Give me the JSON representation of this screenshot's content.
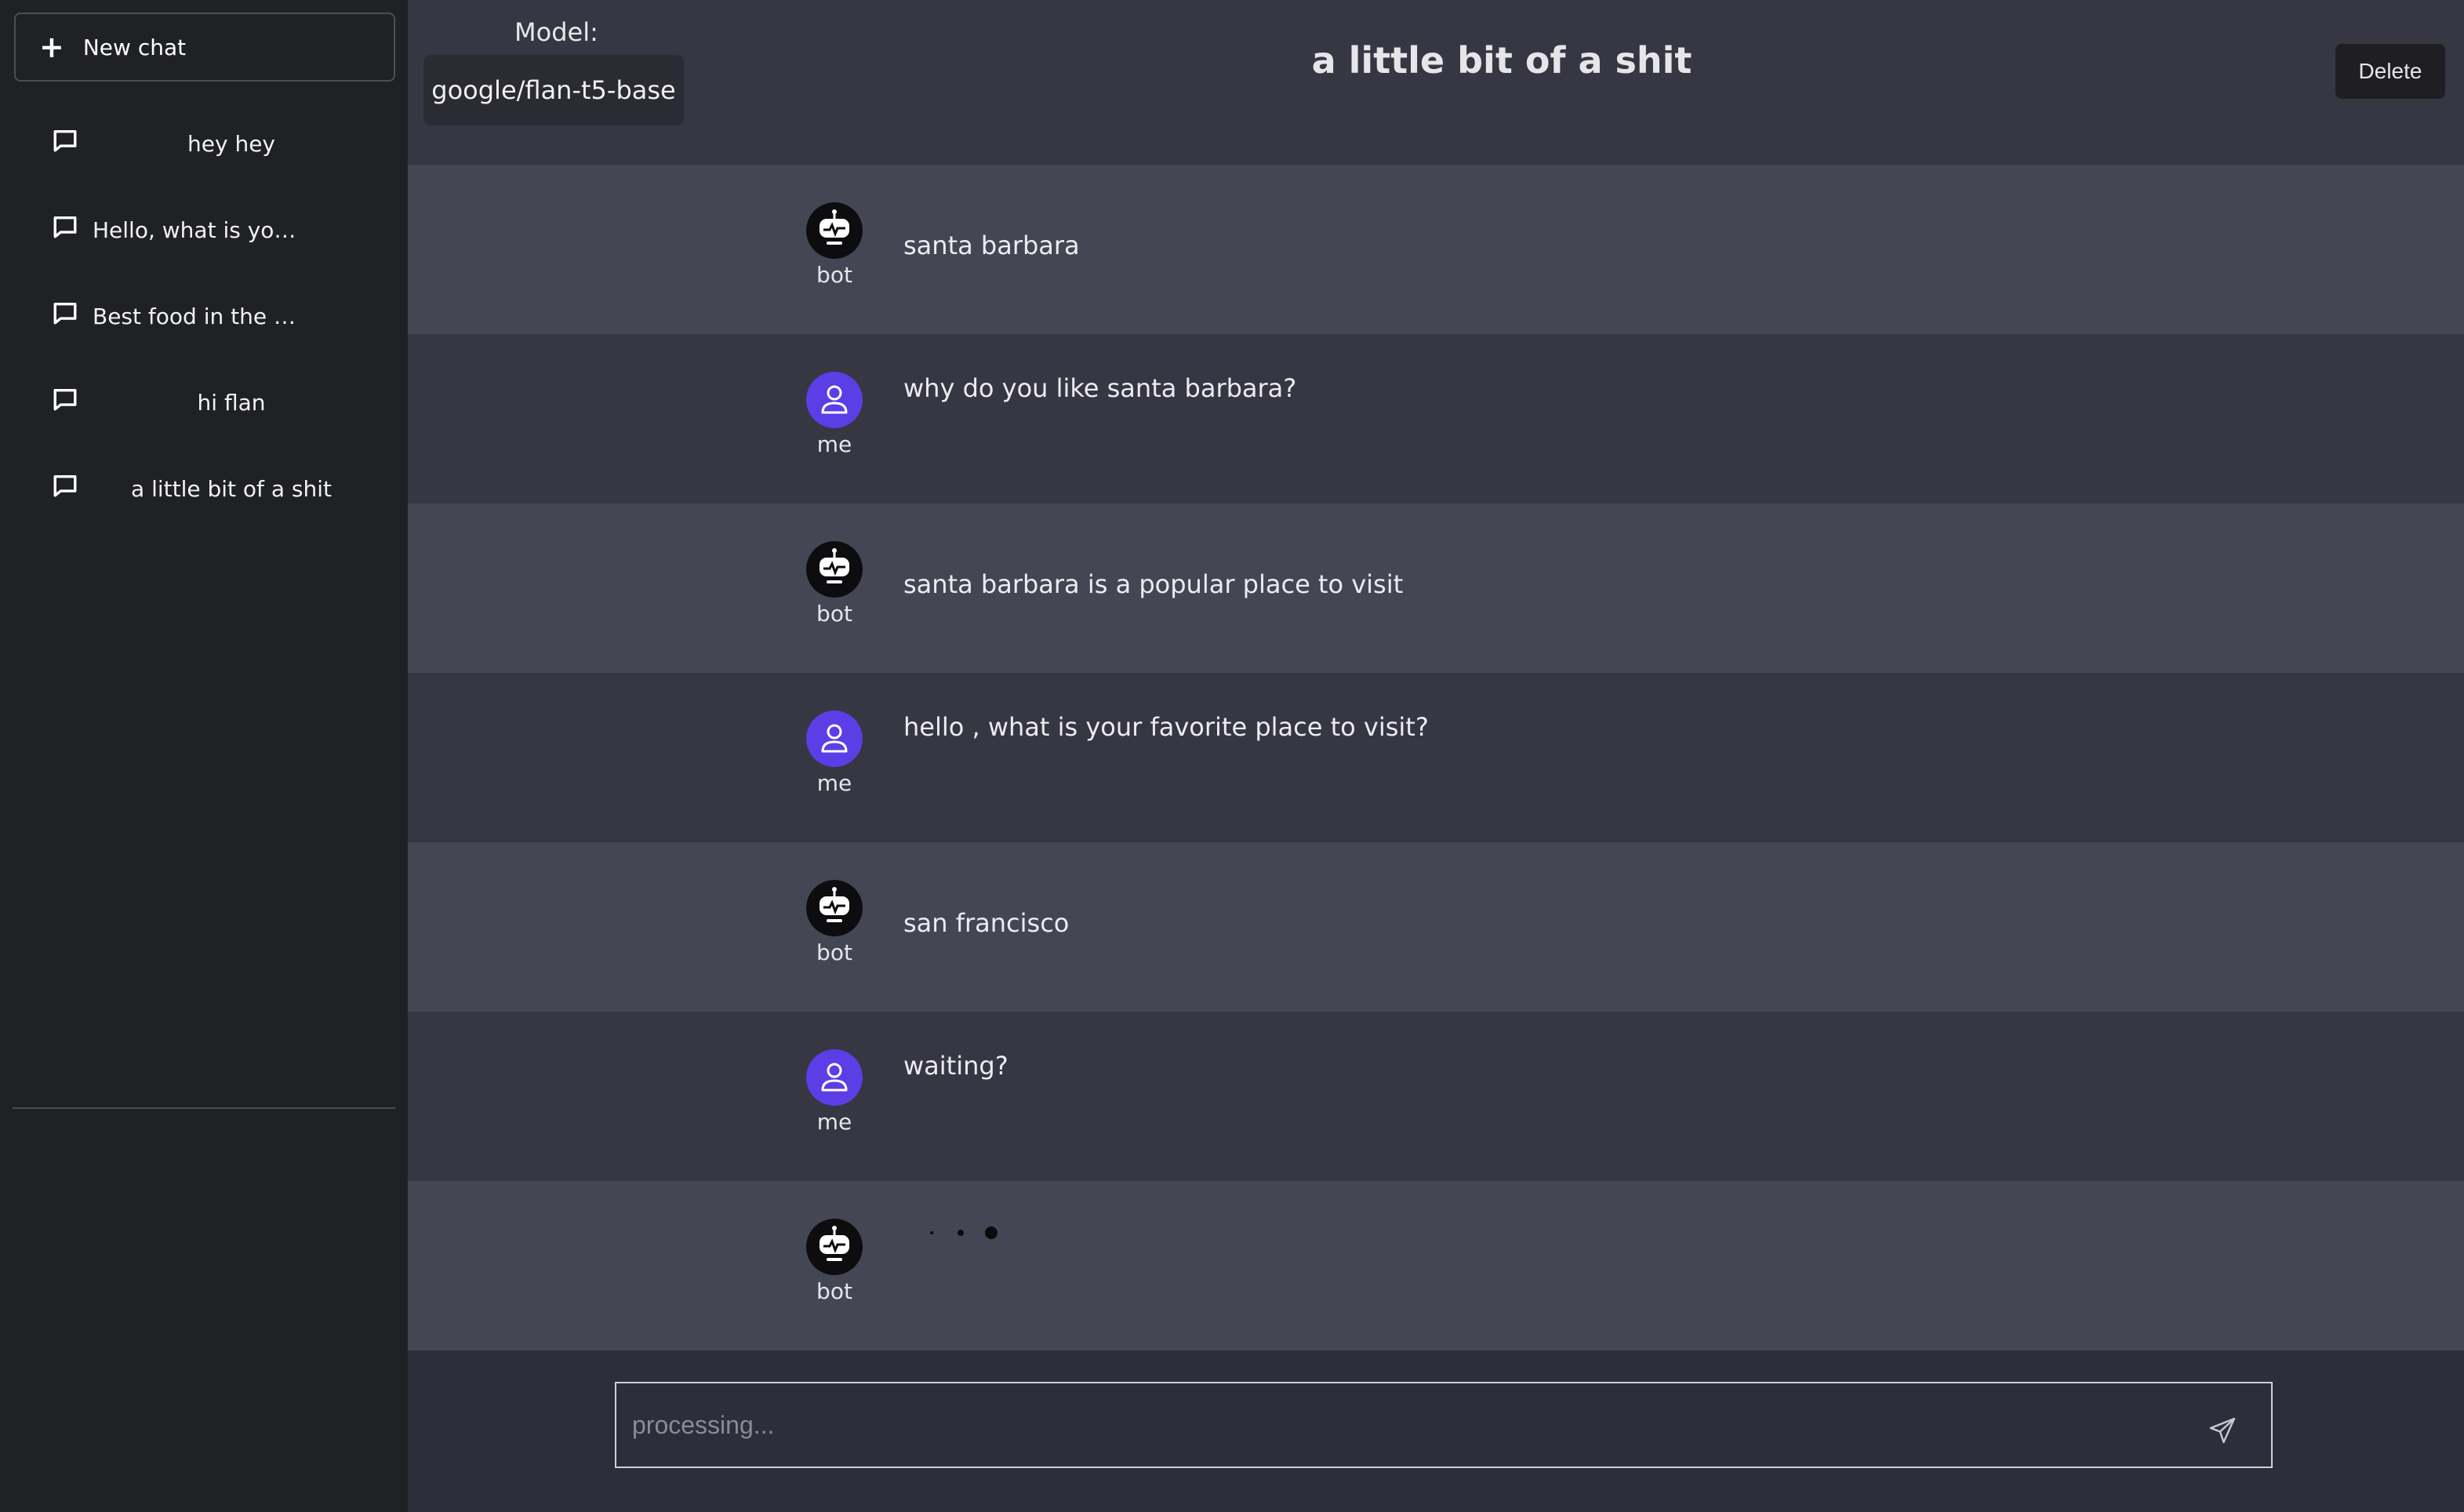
{
  "sidebar": {
    "new_chat_label": "New chat",
    "items": [
      {
        "label": "hey hey"
      },
      {
        "label": "Hello, what is yo…"
      },
      {
        "label": "Best food in the …"
      },
      {
        "label": "hi flan"
      },
      {
        "label": "a little bit of a shit"
      }
    ]
  },
  "header": {
    "model_label": "Model:",
    "model_value": "google/flan-t5-base",
    "title": "a little bit of a shit",
    "delete_label": "Delete"
  },
  "messages": [
    {
      "role": "bot",
      "text": "santa barbara"
    },
    {
      "role": "me",
      "text": "why do you like santa barbara?"
    },
    {
      "role": "bot",
      "text": "santa barbara is a popular place to visit"
    },
    {
      "role": "me",
      "text": "hello , what is your favorite place to visit?"
    },
    {
      "role": "bot",
      "text": "san francisco"
    },
    {
      "role": "me",
      "text": "waiting?"
    },
    {
      "role": "bot",
      "text": ""
    }
  ],
  "composer": {
    "placeholder": "processing..."
  },
  "colors": {
    "user_avatar": "#5b3ee6",
    "bot_row": "#444654",
    "user_row": "#363742",
    "sidebar": "#202124"
  },
  "icons": {
    "new_chat": "plus-icon",
    "chat_item": "chat-bubble-icon",
    "bot_avatar": "robot-icon",
    "user_avatar": "user-icon",
    "send": "send-icon"
  }
}
